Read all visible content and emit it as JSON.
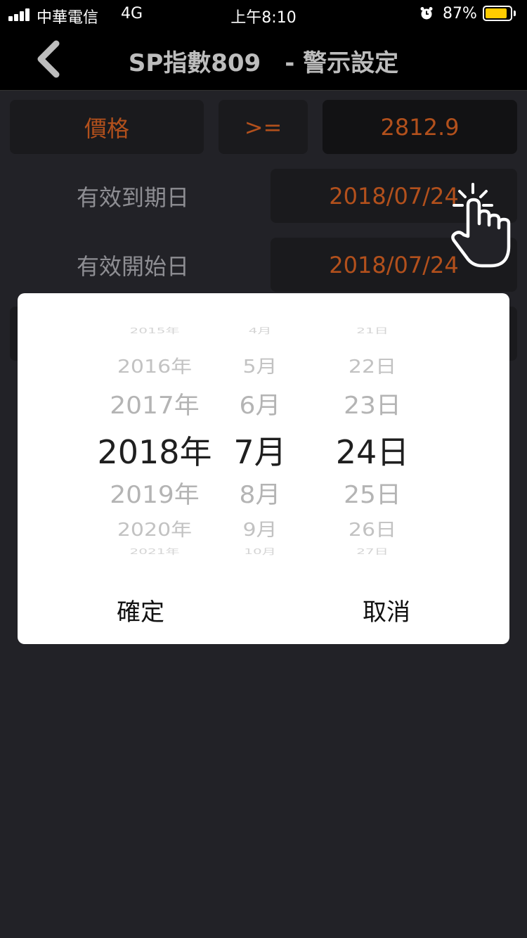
{
  "status_bar": {
    "carrier": "中華電信",
    "network": "4G",
    "time": "上午8:10",
    "battery_percent": "87%",
    "battery_level": 0.87
  },
  "nav": {
    "title": "SP指數809　- 警示設定",
    "back_icon": "chevron-left-icon"
  },
  "condition": {
    "field": "價格",
    "operator": ">=",
    "value": "2812.9"
  },
  "expiry": {
    "label": "有效到期日",
    "value": "2018/07/24"
  },
  "start": {
    "label": "有效開始日",
    "value": "2018/07/24"
  },
  "picker": {
    "years": [
      "2015年",
      "2016年",
      "2017年",
      "2018年",
      "2019年",
      "2020年",
      "2021年"
    ],
    "months": [
      "4月",
      "5月",
      "6月",
      "7月",
      "8月",
      "9月",
      "10月"
    ],
    "days": [
      "21日",
      "22日",
      "23日",
      "24日",
      "25日",
      "26日",
      "27日"
    ],
    "confirm_label": "確定",
    "cancel_label": "取消"
  },
  "colors": {
    "accent_orange": "#b2501c",
    "background": "#222227",
    "battery": "#ffcc00"
  }
}
